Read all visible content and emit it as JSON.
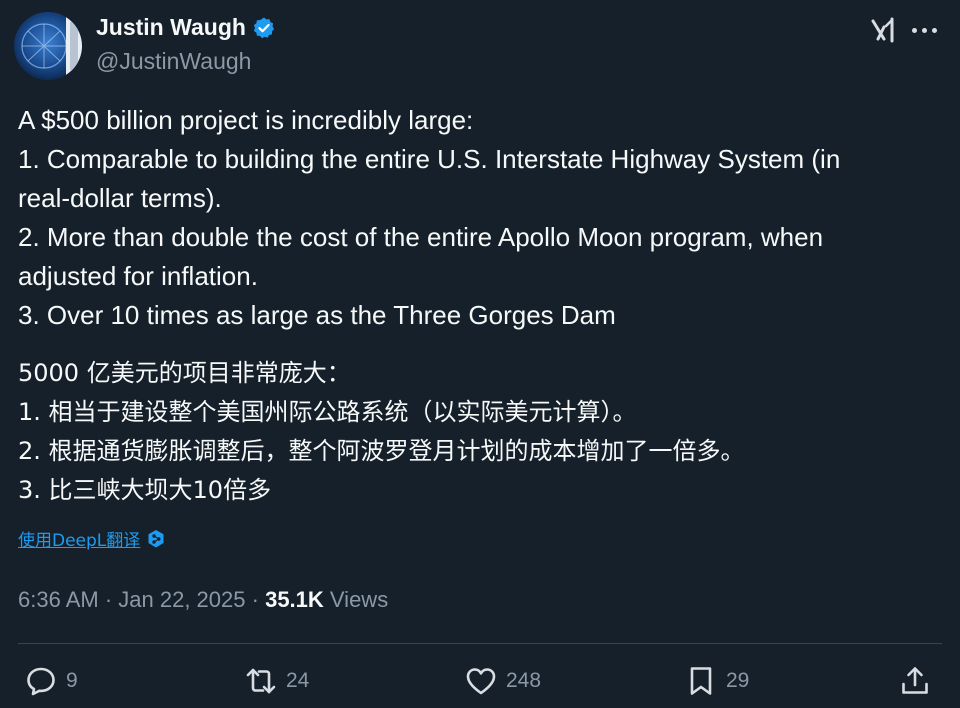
{
  "author": {
    "name": "Justin Waugh",
    "handle": "@JustinWaugh",
    "verified": true,
    "verified_color": "#1d9bf0"
  },
  "header_icons": [
    "grok-icon",
    "more-options-icon"
  ],
  "tweet": {
    "english": [
      [
        "A $500 billion project is incredibly large:"
      ],
      [
        "1. Comparable to building the entire U.S. Interstate Highway System (in",
        "real-dollar terms)."
      ],
      [
        "2. More than double the cost of the entire Apollo Moon program, when",
        "adjusted for inflation."
      ],
      [
        "3. Over 10 times as large as the Three Gorges Dam"
      ]
    ],
    "chinese": [
      "5000 亿美元的项目非常庞大：",
      "1. 相当于建设整个美国州际公路系统（以实际美元计算）。",
      "2. 根据通货膨胀调整后，整个阿波罗登月计划的成本增加了一倍多。",
      "3. 比三峡大坝大10倍多"
    ]
  },
  "translate": {
    "label": "使用DeepL翻译",
    "icon": "deepl-icon"
  },
  "meta": {
    "time": "6:36 AM",
    "separator": " · ",
    "date": "Jan 22, 2025",
    "views_count": "35.1K",
    "views_label": " Views"
  },
  "actions": {
    "replies": "9",
    "reposts": "24",
    "likes": "248",
    "bookmarks": "29"
  },
  "colors": {
    "background": "#15202b",
    "text": "#f7f9f9",
    "secondary": "#8b98a5",
    "accent": "#1d9bf0"
  }
}
